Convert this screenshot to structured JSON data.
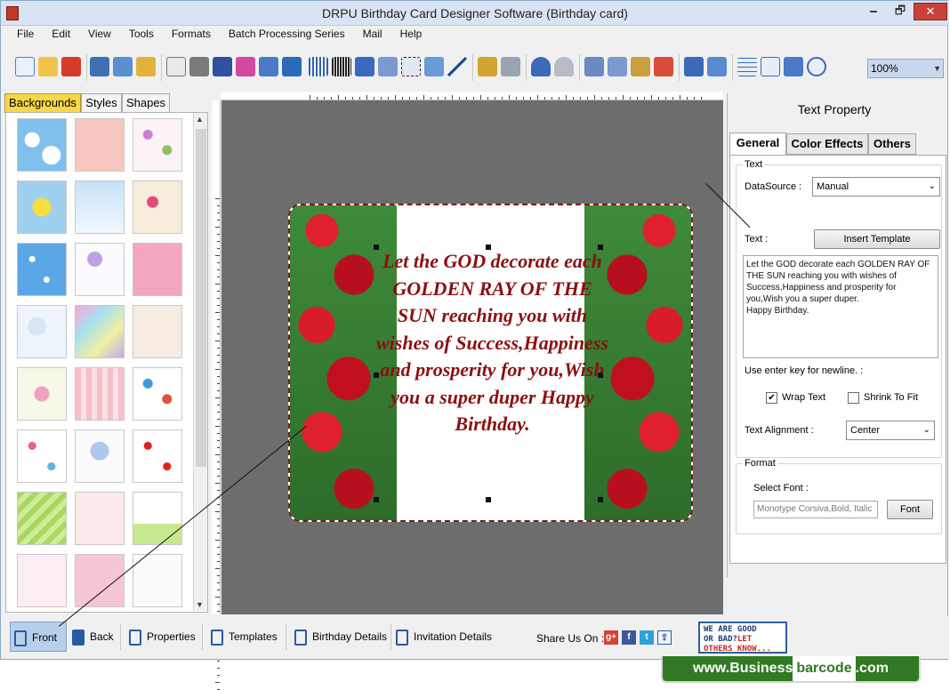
{
  "window": {
    "title": "DRPU Birthday Card Designer Software (Birthday card)",
    "min": "🗕",
    "max": "🗗",
    "close": "✕"
  },
  "menu": [
    "File",
    "Edit",
    "View",
    "Tools",
    "Formats",
    "Batch Processing Series",
    "Mail",
    "Help"
  ],
  "toolbar": {
    "zoom": "100%",
    "icons": [
      "new-icon",
      "open-icon",
      "close-doc-icon",
      "save-icon",
      "save-as-icon",
      "export-icon",
      "print-preview-icon",
      "print-icon",
      "layers-icon",
      "copy-object-icon",
      "pencil-icon",
      "image-icon",
      "barcode-icon",
      "barcode2-icon",
      "text-icon",
      "font-color-icon",
      "signature-icon",
      "mail-icon",
      "line-icon",
      "database-icon",
      "database2-icon",
      "undo-icon",
      "redo-icon",
      "cut-icon",
      "copy-icon",
      "paste-icon",
      "delete-icon",
      "bring-front-icon",
      "send-back-icon",
      "grid-icon",
      "actual-size-icon",
      "fit-icon",
      "zoom-icon"
    ]
  },
  "left_tabs": [
    "Backgrounds",
    "Styles",
    "Shapes"
  ],
  "card": {
    "text": "Let the GOD decorate each GOLDEN RAY OF THE SUN reaching you with wishes of Success,Happiness and prosperity for you,Wish you a super duper Happy Birthday."
  },
  "bottom": {
    "front": "Front",
    "back": "Back",
    "properties": "Properties",
    "templates": "Templates",
    "birthday_details": "Birthday Details",
    "invitation_details": "Invitation Details",
    "share": "Share Us On :"
  },
  "goodbad": {
    "line1": "WE ARE GOOD",
    "line2a": "OR BAD?",
    "line2b": "LET",
    "line3": "OTHERS KNOW..."
  },
  "right": {
    "title": "Text Property",
    "tabs": [
      "General",
      "Color Effects",
      "Others"
    ],
    "group_text": "Text",
    "datasource_label": "DataSource :",
    "datasource_value": "Manual",
    "text_label": "Text :",
    "insert_template": "Insert Template",
    "text_value": "Let the GOD decorate each GOLDEN RAY OF THE SUN reaching you with wishes of Success,Happiness and prosperity for you,Wish you a super duper.\nHappy Birthday.",
    "enter_hint": "Use enter key for newline. :",
    "wrap_text": "Wrap Text",
    "wrap_checked": "✔",
    "shrink": "Shrink To Fit",
    "align_label": "Text Alignment :",
    "align_value": "Center",
    "group_format": "Format",
    "select_font": "Select Font :",
    "font_value": "Monotype Corsiva,Bold, Italic",
    "font_btn": "Font"
  },
  "banner": {
    "part1": "www.Business",
    "part2": "barcode",
    "part3": ".com"
  },
  "colors": {
    "accent": "#f7d64a",
    "card_text": "#8b0f10"
  }
}
